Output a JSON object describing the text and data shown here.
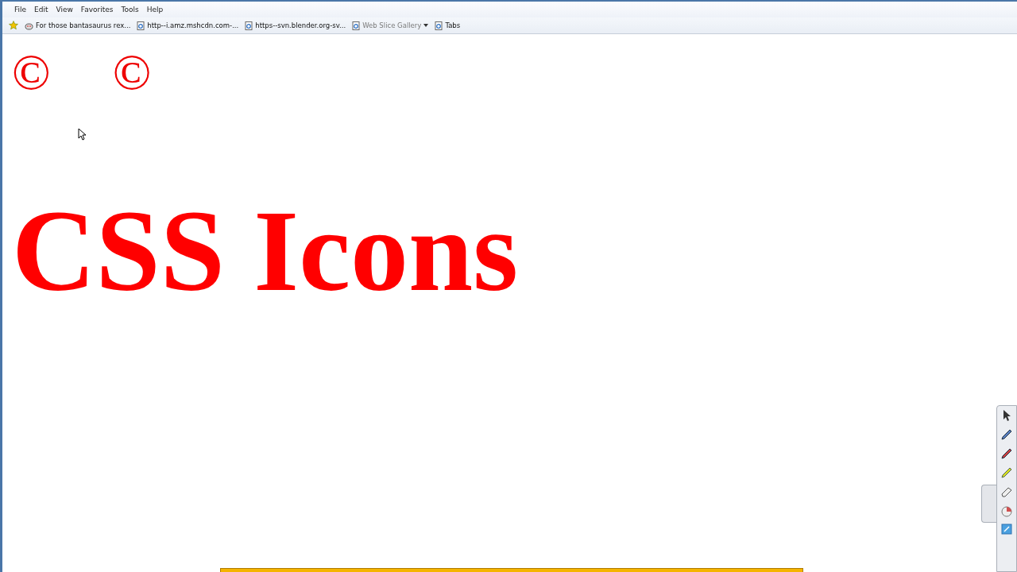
{
  "menu_bar": {
    "items": [
      "File",
      "Edit",
      "View",
      "Favorites",
      "Tools",
      "Help"
    ]
  },
  "favorites_bar": {
    "items": [
      {
        "label": "For those bantasaurus rex...",
        "kind": "feed",
        "dropdown": false,
        "disabled": false
      },
      {
        "label": "http--i.amz.mshcdn.com-...",
        "kind": "page",
        "dropdown": false,
        "disabled": false
      },
      {
        "label": "https--svn.blender.org-sv...",
        "kind": "page",
        "dropdown": false,
        "disabled": false
      },
      {
        "label": "Web Slice Gallery",
        "kind": "page",
        "dropdown": true,
        "disabled": true
      },
      {
        "label": "Tabs",
        "kind": "page",
        "dropdown": false,
        "disabled": false
      }
    ]
  },
  "page": {
    "symbols": [
      "©",
      "©"
    ],
    "heading": "CSS Icons"
  }
}
